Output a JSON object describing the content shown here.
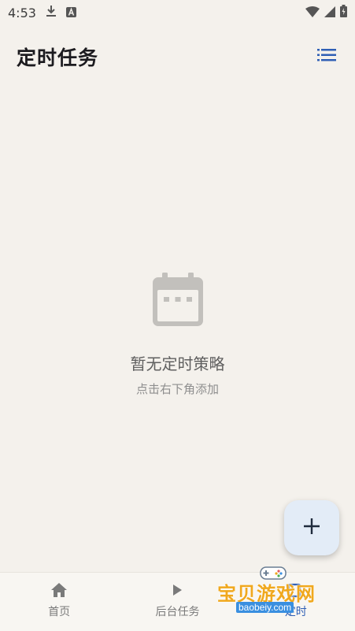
{
  "status_bar": {
    "time": "4:53",
    "icons": [
      "download-icon",
      "a-badge-icon",
      "wifi-icon",
      "signal-icon",
      "battery-icon"
    ]
  },
  "app_bar": {
    "title": "定时任务",
    "menu_icon": "list-icon"
  },
  "empty_state": {
    "icon": "calendar-icon",
    "title": "暂无定时策略",
    "subtitle": "点击右下角添加"
  },
  "fab": {
    "icon": "plus-icon"
  },
  "bottom_nav": {
    "items": [
      {
        "label": "首页",
        "icon": "home-icon",
        "active": false
      },
      {
        "label": "后台任务",
        "icon": "play-icon",
        "active": false
      },
      {
        "label": "定时",
        "icon": "timer-icon",
        "active": true
      }
    ]
  },
  "watermark": {
    "text": "宝贝游戏网",
    "url": "baobeiy.com"
  },
  "colors": {
    "background": "#f4f1ec",
    "accent": "#2f5fb5",
    "fab_background": "#e3ecf7",
    "icon_gray": "#c2c0bc"
  }
}
